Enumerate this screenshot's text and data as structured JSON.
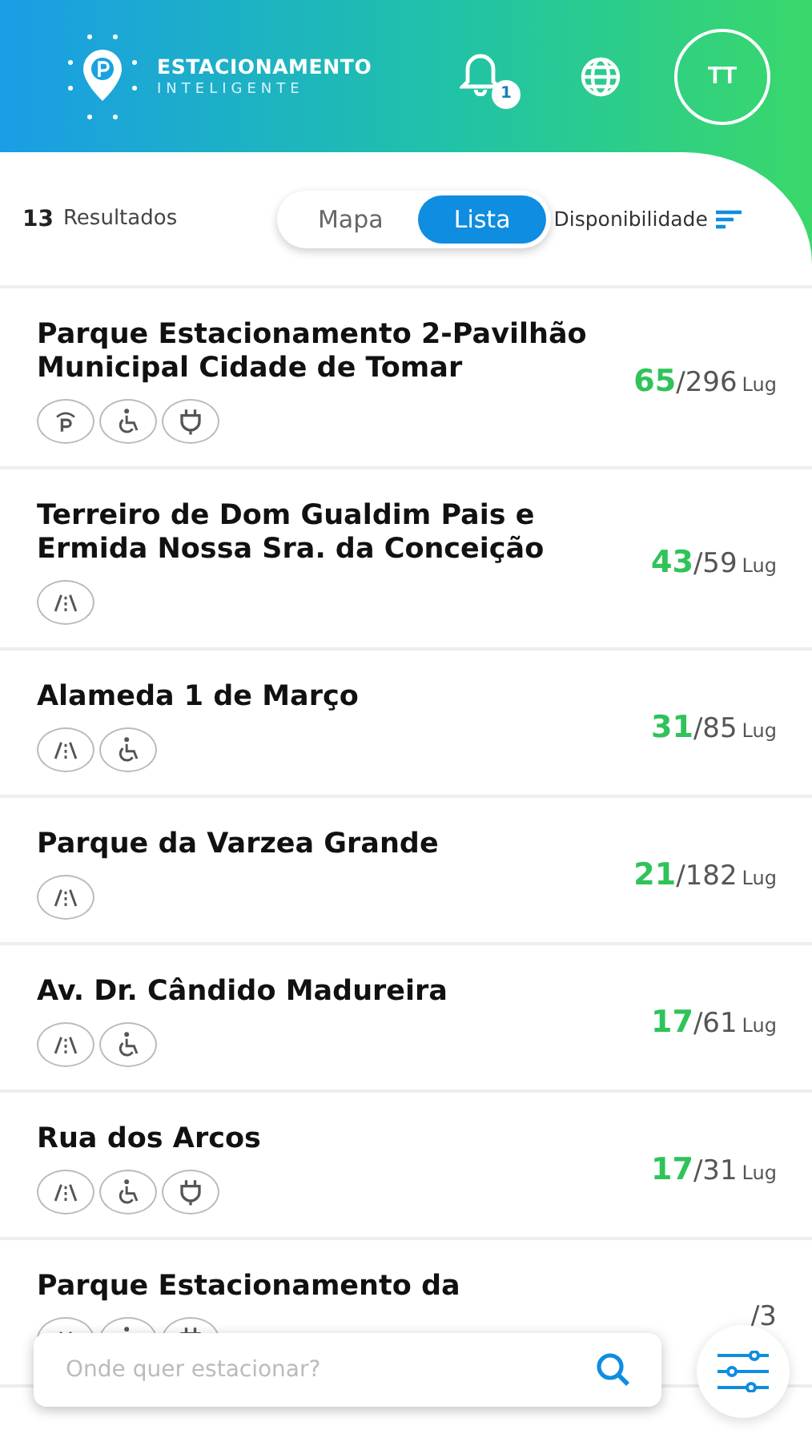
{
  "header": {
    "brand_title": "ESTACIONAMENTO",
    "brand_subtitle": "INTELIGENTE",
    "notification_count": "1",
    "avatar_initials": "TT"
  },
  "toolbar": {
    "count": "13",
    "count_label": "Resultados",
    "tabs": [
      {
        "label": "Mapa",
        "selected": false
      },
      {
        "label": "Lista",
        "selected": true
      }
    ],
    "sort_label": "Disponibilidade"
  },
  "parks": [
    {
      "name": "Parque Estacionamento 2-Pavilhão Municipal Cidade de Tomar",
      "available": "65",
      "total": "/296",
      "unit": "Lug",
      "amenities": [
        {
          "kind": "covered"
        },
        {
          "kind": "accessible"
        },
        {
          "kind": "ev"
        }
      ]
    },
    {
      "name": "Terreiro de Dom Gualdim Pais e Ermida Nossa Sra. da Conceição",
      "available": "43",
      "total": "/59",
      "unit": "Lug",
      "amenities": [
        {
          "kind": "outdoor"
        }
      ]
    },
    {
      "name": "Alameda 1 de Março",
      "available": "31",
      "total": "/85",
      "unit": "Lug",
      "amenities": [
        {
          "kind": "outdoor"
        },
        {
          "kind": "accessible"
        }
      ]
    },
    {
      "name": "Parque da Varzea Grande",
      "available": "21",
      "total": "/182",
      "unit": "Lug",
      "amenities": [
        {
          "kind": "outdoor"
        }
      ]
    },
    {
      "name": "Av. Dr. Cândido Madureira",
      "available": "17",
      "total": "/61",
      "unit": "Lug",
      "amenities": [
        {
          "kind": "outdoor"
        },
        {
          "kind": "accessible"
        }
      ]
    },
    {
      "name": "Rua dos Arcos",
      "available": "17",
      "total": "/31",
      "unit": "Lug",
      "amenities": [
        {
          "kind": "outdoor"
        },
        {
          "kind": "accessible"
        },
        {
          "kind": "ev"
        }
      ]
    },
    {
      "name": "Parque Estacionamento da",
      "total": "/3",
      "amenities": [
        {
          "kind": "outdoor"
        },
        {
          "kind": "accessible"
        },
        {
          "kind": "ev"
        }
      ]
    }
  ],
  "search": {
    "placeholder": "Onde quer estacionar?"
  }
}
